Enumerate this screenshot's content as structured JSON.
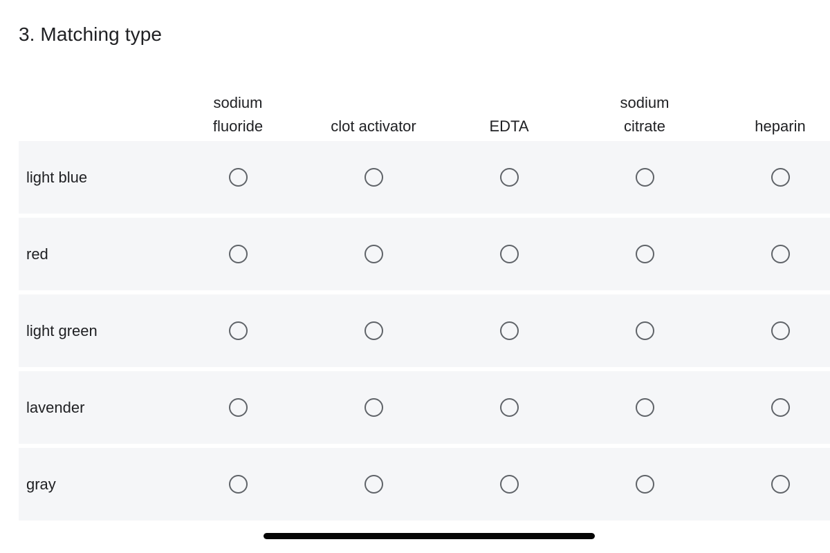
{
  "question": {
    "number": "3.",
    "title": "3. Matching type"
  },
  "matrix": {
    "columns": [
      {
        "label": "sodium fluoride",
        "line1": "sodium",
        "line2": "fluoride",
        "wraps": true
      },
      {
        "label": "clot activator",
        "line1": "clot activator",
        "line2": "",
        "wraps": false
      },
      {
        "label": "EDTA",
        "line1": "EDTA",
        "line2": "",
        "wraps": false
      },
      {
        "label": "sodium citrate",
        "line1": "sodium",
        "line2": "citrate",
        "wraps": true
      },
      {
        "label": "heparin",
        "line1": "heparin",
        "line2": "",
        "wraps": false
      }
    ],
    "rows": [
      {
        "label": "light blue",
        "selected": null
      },
      {
        "label": "red",
        "selected": null
      },
      {
        "label": "light green",
        "selected": null
      },
      {
        "label": "lavender",
        "selected": null
      },
      {
        "label": "gray",
        "selected": null
      }
    ],
    "radio_icon": "radio-unselected-icon",
    "row_background": "#f5f6f8",
    "radio_border_color": "#5f6368",
    "text_color": "#202124"
  },
  "system": {
    "home_indicator": "home-indicator-bar",
    "home_indicator_color": "#050505"
  }
}
